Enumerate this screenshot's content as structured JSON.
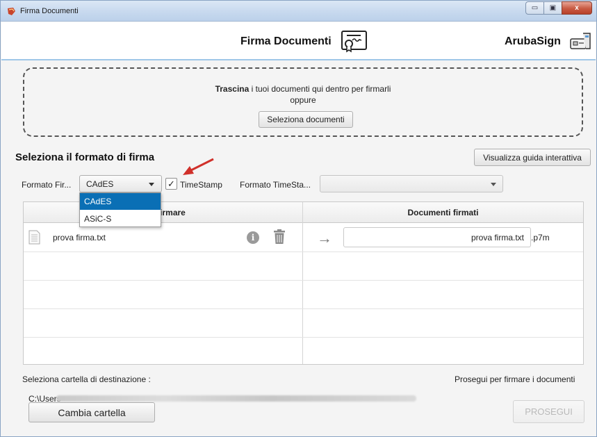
{
  "window": {
    "title": "Firma Documenti",
    "min_glyph": "▭",
    "max_glyph": "▣",
    "close_glyph": "x"
  },
  "header": {
    "title": "Firma Documenti",
    "brand": "ArubaSign"
  },
  "dropzone": {
    "bold_text": "Trascina",
    "text": " i tuoi documenti qui dentro per firmarli",
    "or_text": "oppure",
    "select_button": "Seleziona documenti"
  },
  "format_section": {
    "title": "Seleziona il formato di firma",
    "guide_button": "Visualizza guida interattiva",
    "format_label": "Formato Fir...",
    "format_value": "CAdES",
    "format_options": [
      "CAdES",
      "ASiC-S"
    ],
    "timestamp_checked": true,
    "timestamp_label": "TimeStamp",
    "timestamp_format_label": "Formato TimeSta...",
    "timestamp_format_value": ""
  },
  "table": {
    "col1_header": "i da firmare",
    "col2_header": "Documenti firmati",
    "rows": [
      {
        "name": "prova firma.txt",
        "output_name": "prova firma.txt",
        "extension": ".p7m"
      }
    ]
  },
  "footer": {
    "dest_label": "Seleziona cartella di destinazione :",
    "proceed_label": "Prosegui per firmare i documenti",
    "path_prefix": "C:\\Users",
    "change_button": "Cambia cartella",
    "proceed_button": "PROSEGUI"
  },
  "colors": {
    "accent": "#0a6fb5",
    "header_border": "#9fc7e8",
    "annotation_arrow": "#d0302a"
  }
}
